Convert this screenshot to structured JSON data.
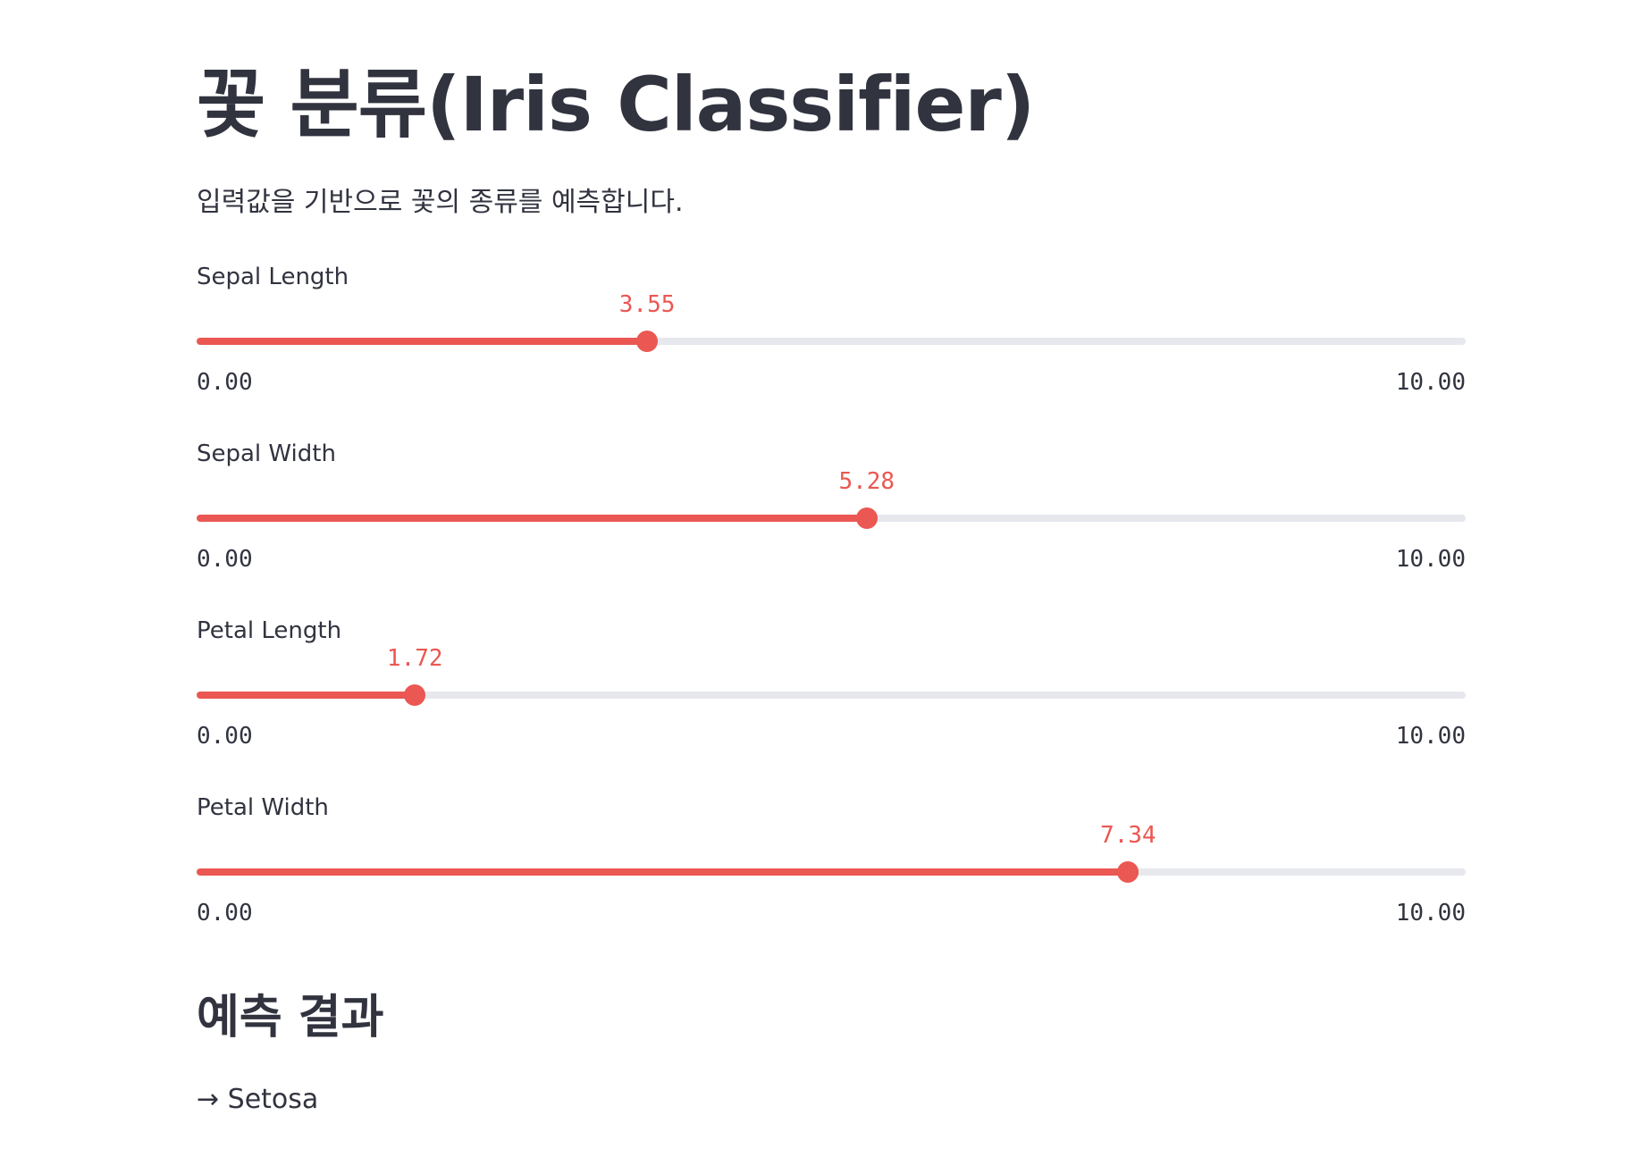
{
  "page": {
    "title": "꽃 분류(Iris Classifier)",
    "subtitle": "입력값을 기반으로 꽃의 종류를 예측합니다."
  },
  "sliders": [
    {
      "label": "Sepal Length",
      "value": 3.55,
      "value_text": "3.55",
      "min": 0,
      "max": 10,
      "min_text": "0.00",
      "max_text": "10.00"
    },
    {
      "label": "Sepal Width",
      "value": 5.28,
      "value_text": "5.28",
      "min": 0,
      "max": 10,
      "min_text": "0.00",
      "max_text": "10.00"
    },
    {
      "label": "Petal Length",
      "value": 1.72,
      "value_text": "1.72",
      "min": 0,
      "max": 10,
      "min_text": "0.00",
      "max_text": "10.00"
    },
    {
      "label": "Petal Width",
      "value": 7.34,
      "value_text": "7.34",
      "min": 0,
      "max": 10,
      "min_text": "0.00",
      "max_text": "10.00"
    }
  ],
  "result": {
    "heading": "예측 결과",
    "text": "→ Setosa"
  },
  "colors": {
    "accent": "#eb5752",
    "track": "#e6e8ee",
    "text": "#31333f"
  }
}
